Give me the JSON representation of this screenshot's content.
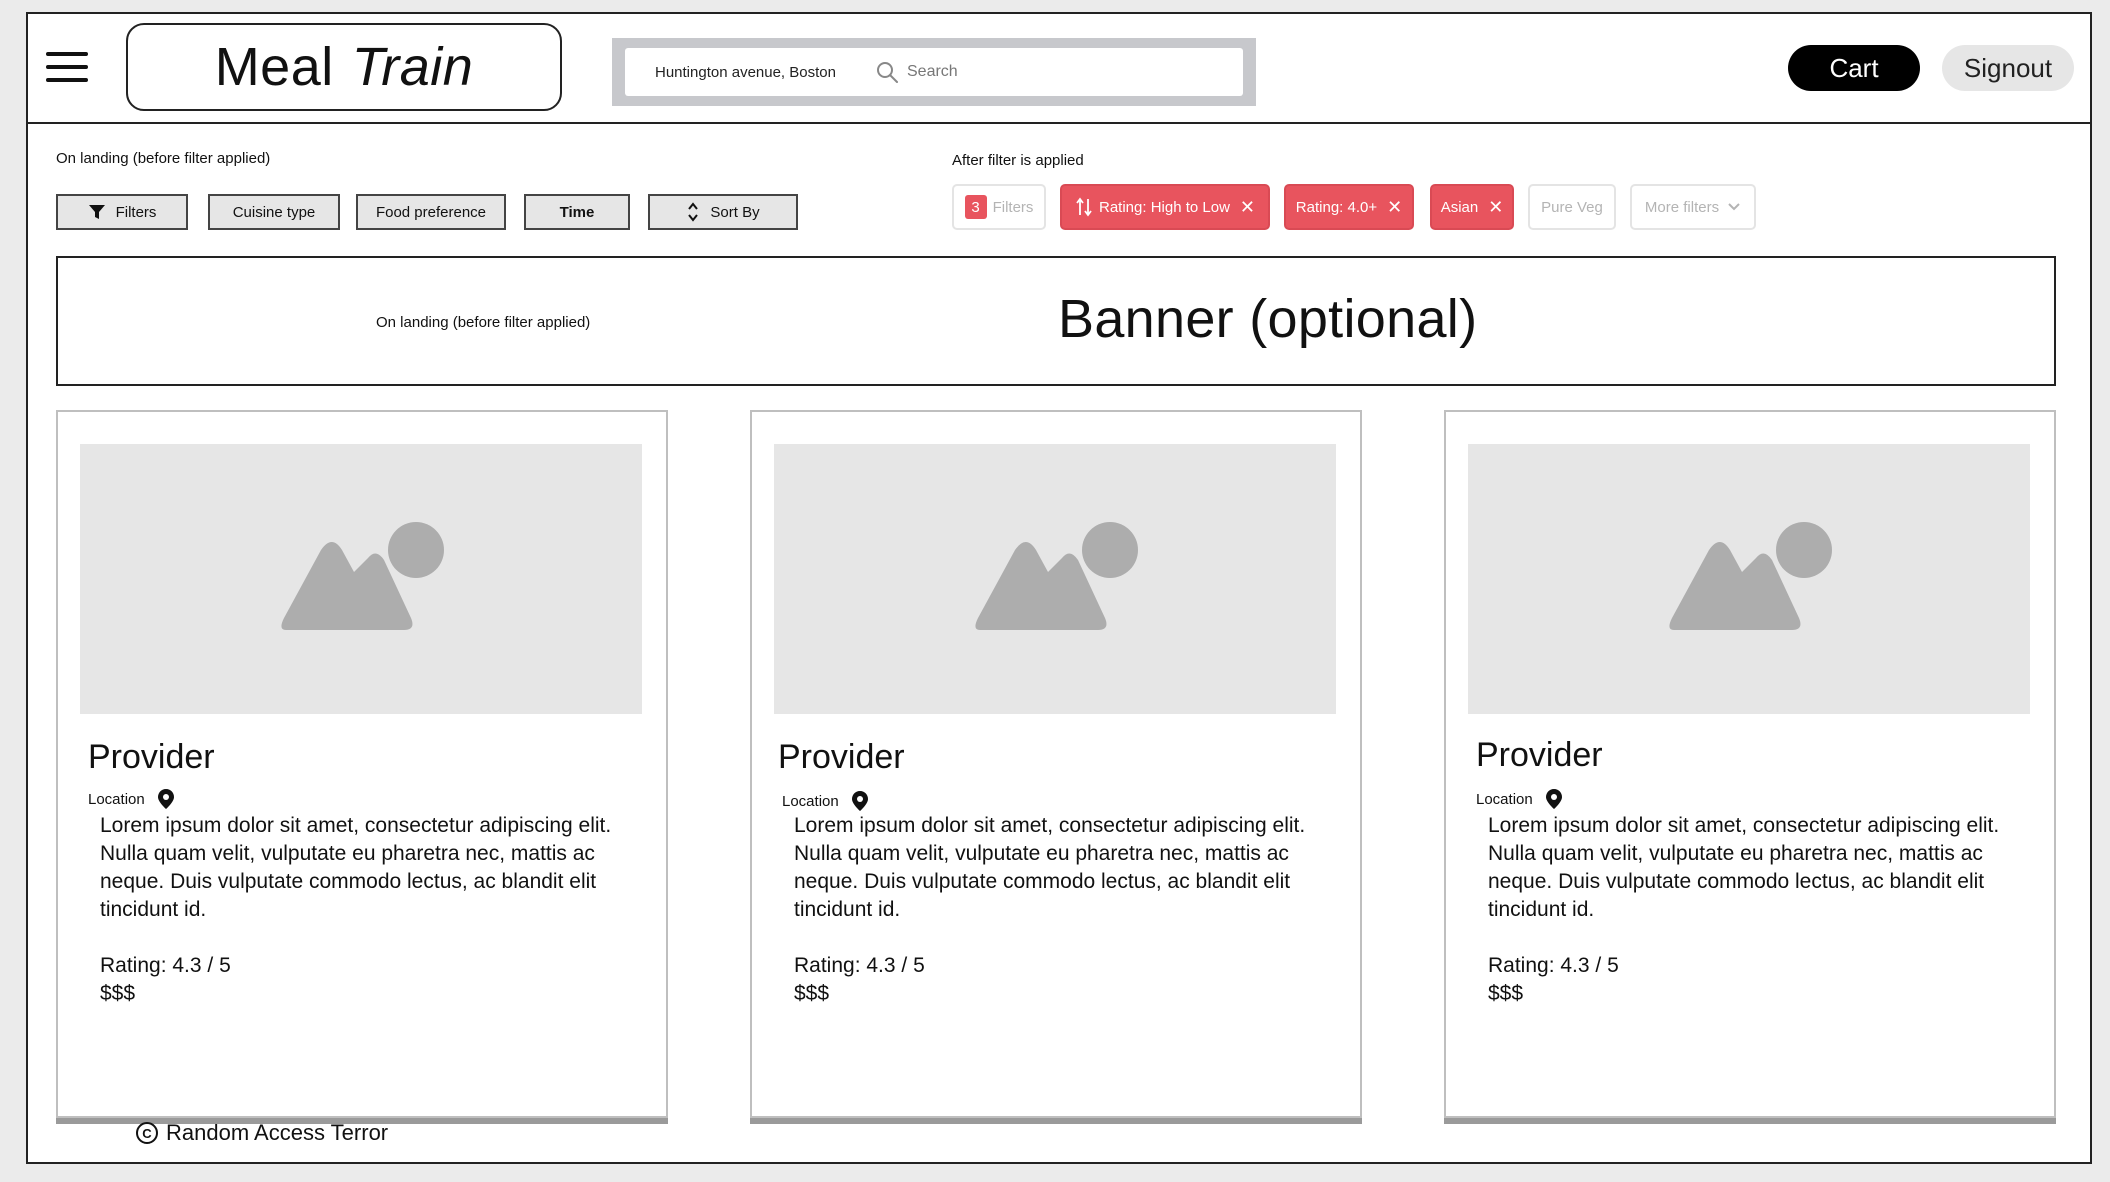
{
  "header": {
    "logo_part1": "Meal",
    "logo_part2": "Train",
    "location_text": "Huntington avenue, Boston",
    "search_placeholder": "Search",
    "cart_label": "Cart",
    "signout_label": "Signout"
  },
  "filters_before": {
    "caption": "On landing (before filter applied)",
    "buttons": [
      "Filters",
      "Cuisine type",
      "Food preference",
      "Time",
      "Sort By"
    ]
  },
  "filters_after": {
    "caption": "After filter is applied",
    "filter_count": "3",
    "filter_label": "Filters",
    "chips": [
      "Rating: High to Low",
      "Rating: 4.0+",
      "Asian",
      "Pure Veg",
      "More filters"
    ]
  },
  "banner": {
    "note": "On landing (before filter applied)",
    "title": "Banner (optional)"
  },
  "cards": [
    {
      "provider": "Provider",
      "location": "Location",
      "description": "Lorem ipsum dolor sit amet, consectetur adipiscing elit. Nulla quam velit, vulputate eu pharetra nec, mattis ac neque. Duis vulputate commodo lectus, ac blandit elit tincidunt id.",
      "rating": "Rating: 4.3 / 5",
      "price": "$$$"
    },
    {
      "provider": "Provider",
      "location": "Location",
      "description": "Lorem ipsum dolor sit amet, consectetur adipiscing elit. Nulla quam velit, vulputate eu pharetra nec, mattis ac neque. Duis vulputate commodo lectus, ac blandit elit tincidunt id.",
      "rating": "Rating: 4.3 / 5",
      "price": "$$$"
    },
    {
      "provider": "Provider",
      "location": "Location",
      "description": "Lorem ipsum dolor sit amet, consectetur adipiscing elit. Nulla quam velit, vulputate eu pharetra nec, mattis ac neque. Duis vulputate commodo lectus, ac blandit elit tincidunt id.",
      "rating": "Rating: 4.3 / 5",
      "price": "$$$"
    }
  ],
  "footer": {
    "text": "Random Access Terror"
  },
  "colors": {
    "accent_red": "#e8545e",
    "placeholder_gray": "#e6e6e6"
  },
  "icons": [
    "menu-icon",
    "search-icon",
    "filter-icon",
    "sort-icon",
    "sort-arrows-icon",
    "close-icon",
    "chevron-down-icon",
    "image-placeholder-icon",
    "location-pin-icon",
    "copyright-icon"
  ]
}
